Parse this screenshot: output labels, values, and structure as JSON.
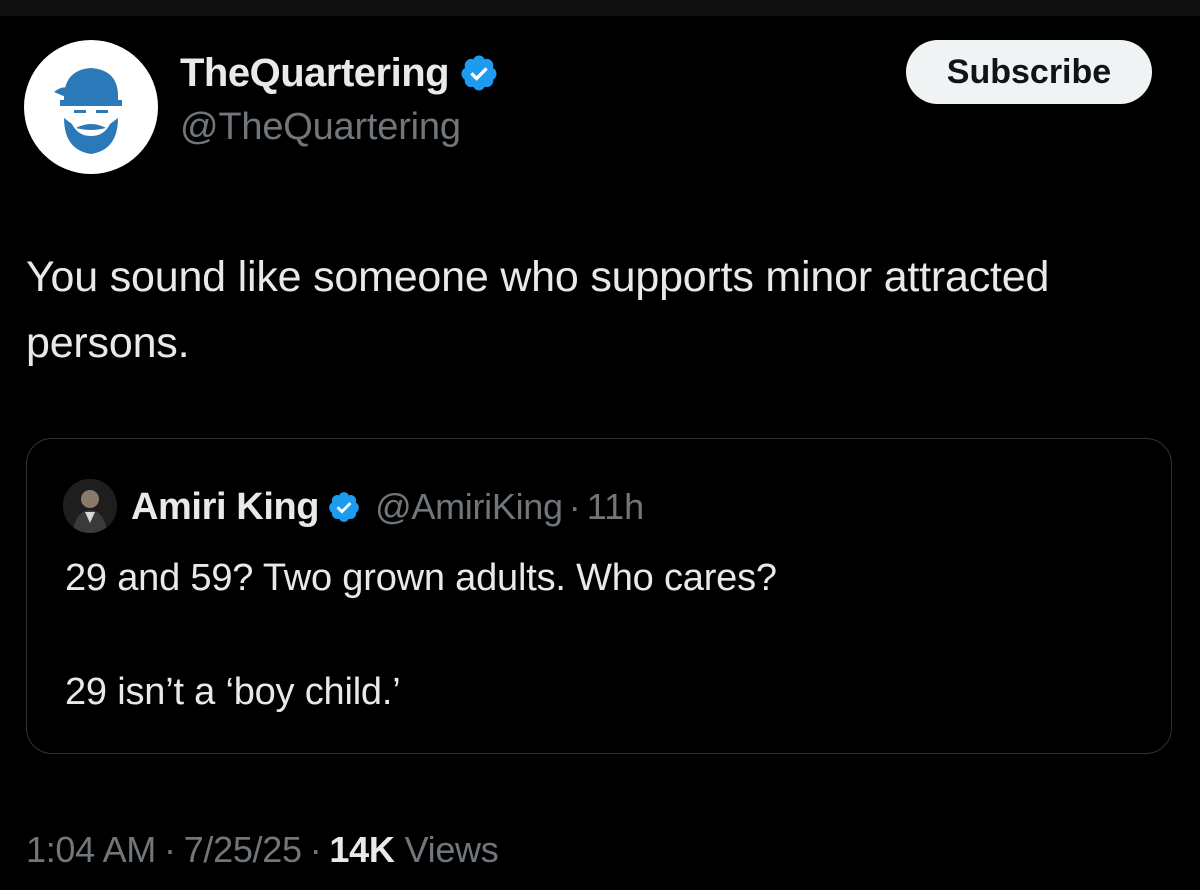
{
  "author": {
    "display_name": "TheQuartering",
    "handle": "@TheQuartering",
    "verified": true,
    "avatar_icon": "bearded-man-logo-icon"
  },
  "subscribe_button": {
    "label": "Subscribe"
  },
  "tweet": {
    "text": "You sound like someone who supports minor attracted persons."
  },
  "quoted_tweet": {
    "display_name": "Amiri King",
    "handle": "@AmiriKing",
    "separator": "·",
    "time_ago": "11h",
    "verified": true,
    "line_1": "29 and 59? Two grown adults. Who cares?",
    "line_2": "29 isn’t a ‘boy child.’"
  },
  "meta": {
    "time": "1:04 AM",
    "dot": "·",
    "date": "7/25/25",
    "views_count": "14K",
    "views_label": "Views"
  },
  "colors": {
    "background": "#000000",
    "primary_text": "#e7e9ea",
    "secondary_text": "#71767b",
    "verified_badge": "#1d9bf0",
    "avatar_logo": "#2b79b8",
    "border": "#2f3336"
  }
}
